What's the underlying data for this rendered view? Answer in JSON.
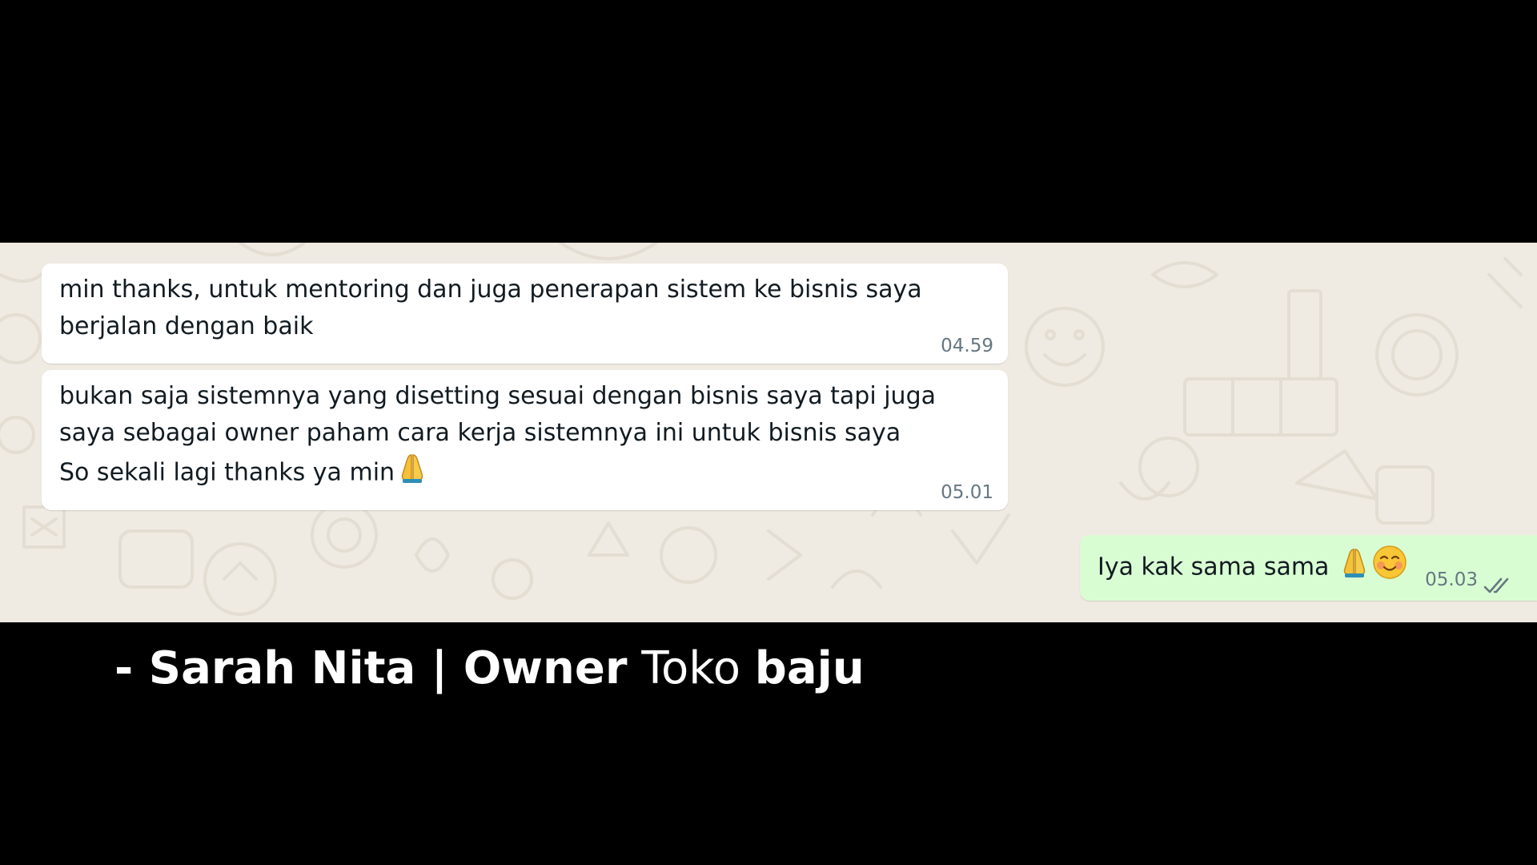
{
  "messages": [
    {
      "direction": "incoming",
      "lines": [
        "min thanks, untuk mentoring dan juga penerapan sistem ke bisnis saya",
        "berjalan dengan baik"
      ],
      "time": "04.59"
    },
    {
      "direction": "incoming",
      "lines": [
        "bukan saja sistemnya yang disetting sesuai dengan bisnis saya tapi juga",
        "saya sebagai owner paham cara kerja sistemnya ini untuk bisnis saya",
        "So sekali lagi thanks ya min"
      ],
      "emoji": [
        "folded-hands-icon"
      ],
      "time": "05.01"
    },
    {
      "direction": "outgoing",
      "text": "Iya kak sama sama",
      "emoji": [
        "folded-hands-icon",
        "smiling-face-icon"
      ],
      "time": "05.03",
      "status": "read-double-check-icon"
    }
  ],
  "caption": {
    "prefix": "- Sarah Nita | Owner",
    "middle": "Toko",
    "suffix": "baju"
  },
  "colors": {
    "background": "#000000",
    "chat_wallpaper": "#efeae2",
    "incoming_bubble": "#ffffff",
    "outgoing_bubble": "#d9fdd3",
    "timestamp": "#667781",
    "caption": "#ffffff"
  }
}
